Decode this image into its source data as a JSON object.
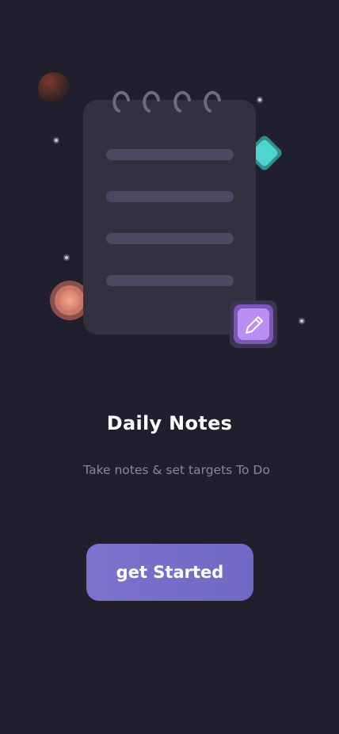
{
  "onboarding": {
    "title": "Daily Notes",
    "subtitle": "Take notes & set targets To Do",
    "cta_label": "get Started"
  },
  "colors": {
    "background": "#211f2d",
    "notepad": "#33313f",
    "notepad_line": "#4b4960",
    "accent": "#7b73cc",
    "pencil_badge": "#b98ff5",
    "diamond": "#4fd5cf",
    "coral": "#ec9b84"
  },
  "icons": [
    "notepad-illustration",
    "pencil-icon",
    "planet-icon",
    "coral-orb-icon",
    "diamond-icon",
    "star-dot-icon"
  ]
}
